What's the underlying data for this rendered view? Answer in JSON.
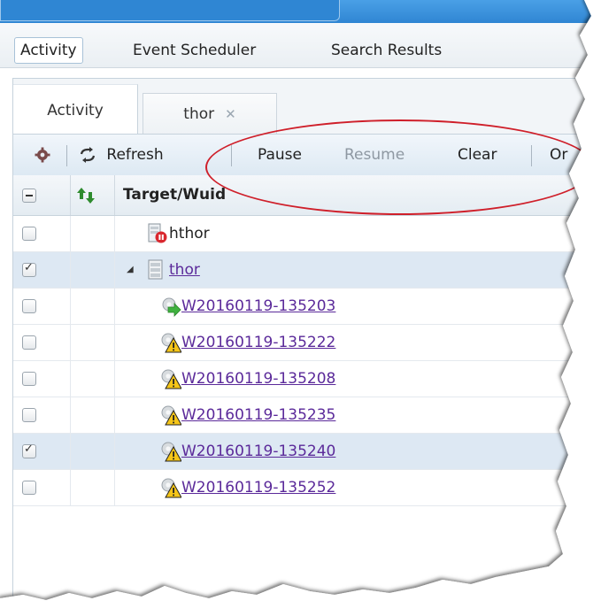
{
  "main_tabs": [
    {
      "label": "Activity",
      "active": true
    },
    {
      "label": "Event Scheduler",
      "active": false
    },
    {
      "label": "Search Results",
      "active": false
    }
  ],
  "sub_tabs": [
    {
      "label": "Activity",
      "active": true,
      "closable": false
    },
    {
      "label": "thor",
      "active": false,
      "closable": true,
      "close_glyph": "✕"
    }
  ],
  "toolbar": {
    "settings_icon": "gear-icon",
    "refresh_icon": "refresh-icon",
    "refresh_label": "Refresh",
    "pause_label": "Pause",
    "resume_label": "Resume",
    "clear_label": "Clear",
    "overflow_label": "Or"
  },
  "grid": {
    "header": {
      "sort_icon": "priority-arrows-icon",
      "column_title": "Target/Wuid"
    },
    "rows": [
      {
        "label": "hthor",
        "level": 1,
        "type": "cluster-paused",
        "link": false,
        "checked": false,
        "selected": false
      },
      {
        "label": "thor",
        "level": 1,
        "type": "cluster",
        "link": true,
        "checked": true,
        "selected": true,
        "expanded": true
      },
      {
        "label": "W20160119-135203",
        "level": 2,
        "type": "workunit-running",
        "link": true,
        "checked": false,
        "selected": false
      },
      {
        "label": "W20160119-135222",
        "level": 2,
        "type": "workunit-warning",
        "link": true,
        "checked": false,
        "selected": false
      },
      {
        "label": "W20160119-135208",
        "level": 2,
        "type": "workunit-warning",
        "link": true,
        "checked": false,
        "selected": false
      },
      {
        "label": "W20160119-135235",
        "level": 2,
        "type": "workunit-warning",
        "link": true,
        "checked": false,
        "selected": false
      },
      {
        "label": "W20160119-135240",
        "level": 2,
        "type": "workunit-warning",
        "link": true,
        "checked": true,
        "selected": true
      },
      {
        "label": "W20160119-135252",
        "level": 2,
        "type": "workunit-warning",
        "link": true,
        "checked": false,
        "selected": false
      }
    ]
  },
  "colors": {
    "accent": "#2f86d3",
    "link": "#5b2a9a",
    "annotation": "#cf1f2a",
    "selected_row": "#dde8f3"
  }
}
